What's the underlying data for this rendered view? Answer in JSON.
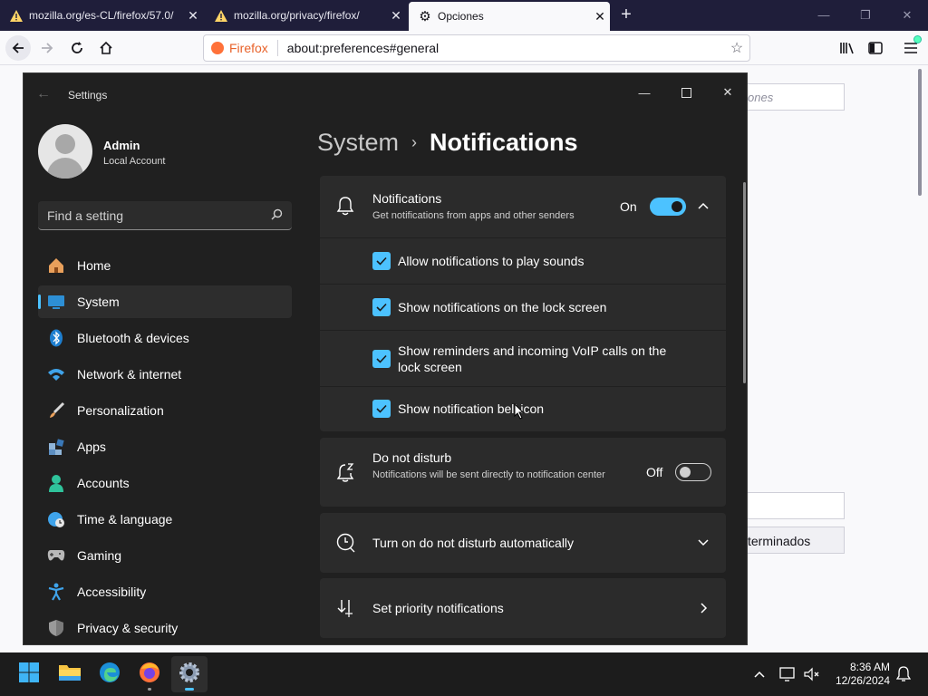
{
  "firefox": {
    "tabs": [
      {
        "label": "mozilla.org/es-CL/firefox/57.0/",
        "icon": "warning-icon"
      },
      {
        "label": "mozilla.org/privacy/firefox/",
        "icon": "warning-icon"
      },
      {
        "label": "Opciones",
        "icon": "gear-icon"
      }
    ],
    "url_brand": "Firefox",
    "url": "about:preferences#general",
    "bg_search_placeholder": "ones",
    "bg_button_label": "terminados"
  },
  "settings": {
    "window_title": "Settings",
    "user": {
      "name": "Admin",
      "account_type": "Local Account"
    },
    "search_placeholder": "Find a setting",
    "nav": [
      {
        "label": "Home",
        "icon": "home-icon",
        "selected": false
      },
      {
        "label": "System",
        "icon": "system-icon",
        "selected": true
      },
      {
        "label": "Bluetooth & devices",
        "icon": "bluetooth-icon",
        "selected": false
      },
      {
        "label": "Network & internet",
        "icon": "wifi-icon",
        "selected": false
      },
      {
        "label": "Personalization",
        "icon": "brush-icon",
        "selected": false
      },
      {
        "label": "Apps",
        "icon": "apps-icon",
        "selected": false
      },
      {
        "label": "Accounts",
        "icon": "accounts-icon",
        "selected": false
      },
      {
        "label": "Time & language",
        "icon": "globe-clock-icon",
        "selected": false
      },
      {
        "label": "Gaming",
        "icon": "gamepad-icon",
        "selected": false
      },
      {
        "label": "Accessibility",
        "icon": "accessibility-icon",
        "selected": false
      },
      {
        "label": "Privacy & security",
        "icon": "shield-icon",
        "selected": false
      }
    ],
    "breadcrumb": {
      "parent": "System",
      "current": "Notifications"
    },
    "notifications": {
      "title": "Notifications",
      "subtitle": "Get notifications from apps and other senders",
      "state_label": "On",
      "enabled": true,
      "options": [
        {
          "label": "Allow notifications to play sounds",
          "checked": true
        },
        {
          "label": "Show notifications on the lock screen",
          "checked": true
        },
        {
          "label": "Show reminders and incoming VoIP calls on the lock screen",
          "checked": true
        },
        {
          "label": "Show notification bell icon",
          "checked": true
        }
      ]
    },
    "dnd": {
      "title": "Do not disturb",
      "subtitle": "Notifications will be sent directly to notification center",
      "state_label": "Off",
      "enabled": false
    },
    "auto_dnd": {
      "title": "Turn on do not disturb automatically"
    },
    "priority": {
      "title": "Set priority notifications"
    }
  },
  "taskbar": {
    "apps": [
      "start-icon",
      "file-explorer-icon",
      "edge-icon",
      "firefox-icon",
      "settings-icon"
    ],
    "time": "8:36 AM",
    "date": "12/26/2024"
  },
  "colors": {
    "accent": "#4cc2ff",
    "window_bg": "#202020",
    "card_bg": "#2b2b2b"
  }
}
